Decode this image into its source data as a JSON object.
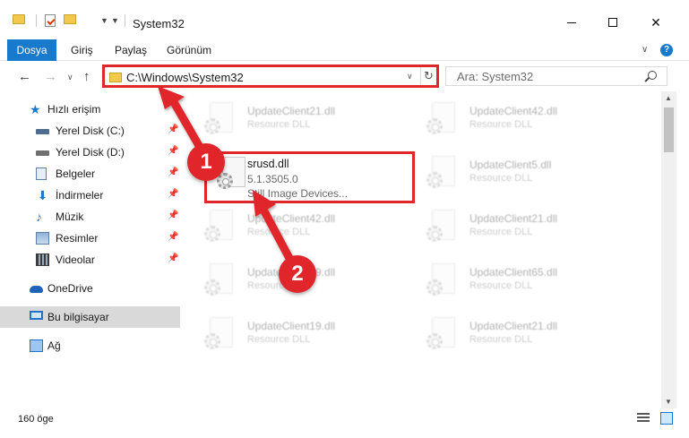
{
  "window": {
    "title": "System32",
    "minimize_label": "",
    "maximize_label": "",
    "close_label": "✕"
  },
  "ribbon": {
    "tabs": [
      "Dosya",
      "Giriş",
      "Paylaş",
      "Görünüm"
    ],
    "help": "?"
  },
  "nav": {
    "address": "C:\\Windows\\System32",
    "search_placeholder": "Ara: System32"
  },
  "sidebar": {
    "quick_access": "Hızlı erişim",
    "items": [
      {
        "label": "Yerel Disk (C:)",
        "icon": "drive-icon"
      },
      {
        "label": "Yerel Disk (D:)",
        "icon": "drive-icon"
      },
      {
        "label": "Belgeler",
        "icon": "documents-icon"
      },
      {
        "label": "İndirmeler",
        "icon": "download-icon"
      },
      {
        "label": "Müzik",
        "icon": "music-icon"
      },
      {
        "label": "Resimler",
        "icon": "pictures-icon"
      },
      {
        "label": "Videolar",
        "icon": "videos-icon"
      }
    ],
    "onedrive": "OneDrive",
    "this_pc": "Bu bilgisayar",
    "network": "Ağ"
  },
  "files": {
    "col1": [
      {
        "name": "UpdateClient21.dll",
        "desc": "Resource DLL"
      },
      {
        "name": "UpdateClient42.dll",
        "desc": "Resource DLL"
      },
      {
        "name": "UpdateClient19.dll",
        "desc": "Resource DLL"
      },
      {
        "name": "UpdateClient19.dll",
        "desc": "Resource DLL"
      }
    ],
    "col2": [
      {
        "name": "UpdateClient42.dll",
        "desc": "Resource DLL"
      },
      {
        "name": "UpdateClient5.dll",
        "desc": "Resource DLL"
      },
      {
        "name": "UpdateClient21.dll",
        "desc": "Resource DLL"
      },
      {
        "name": "UpdateClient65.dll",
        "desc": "Resource DLL"
      },
      {
        "name": "UpdateClient21.dll",
        "desc": "Resource DLL"
      }
    ],
    "highlighted": {
      "name": "srusd.dll",
      "version": "5.1.3505.0",
      "desc": "Still Image Devices..."
    }
  },
  "status": {
    "count": "160 öge"
  },
  "annotations": {
    "step1": "1",
    "step2": "2",
    "color": "#e0262b"
  },
  "colors": {
    "accent": "#1979ca",
    "selection": "#cce8ff"
  }
}
